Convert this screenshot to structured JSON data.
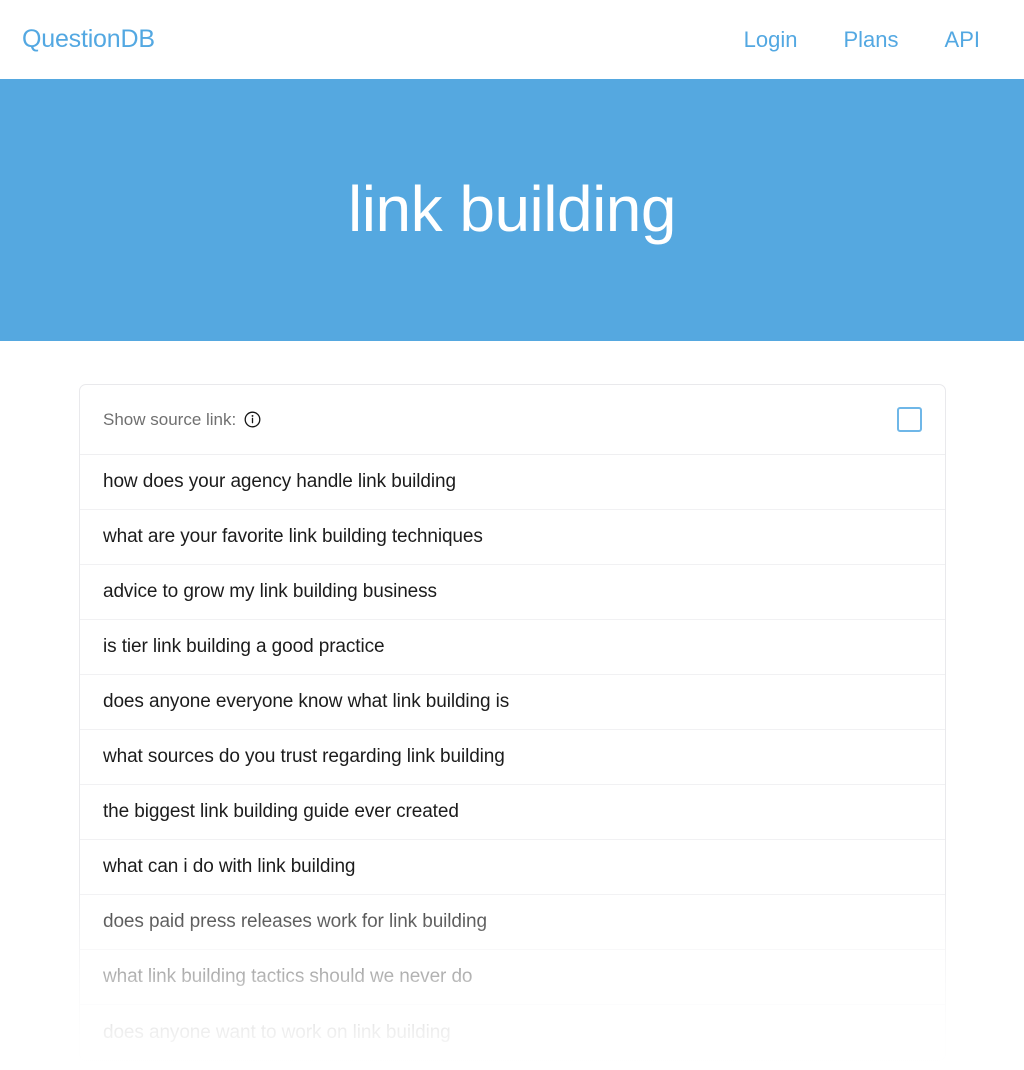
{
  "navbar": {
    "brand": "QuestionDB",
    "links": [
      {
        "label": "Login"
      },
      {
        "label": "Plans"
      },
      {
        "label": "API"
      }
    ]
  },
  "hero": {
    "title": "link building",
    "background_color": "#55a8e0",
    "text_color": "#ffffff"
  },
  "results": {
    "source_link_label": "Show source link:",
    "info_icon": "info-circle-icon",
    "show_source_link_checked": false,
    "accent_color": "#53a8e2",
    "rows": [
      {
        "text": "how does your agency handle link building"
      },
      {
        "text": "what are your favorite link building techniques"
      },
      {
        "text": "advice to grow my link building business"
      },
      {
        "text": "is tier link building a good practice"
      },
      {
        "text": "does anyone everyone know what link building is"
      },
      {
        "text": "what sources do you trust regarding link building"
      },
      {
        "text": "the biggest link building guide ever created"
      },
      {
        "text": "what can i do with link building"
      },
      {
        "text": "does paid press releases work for link building"
      },
      {
        "text": "what link building tactics should we never do"
      },
      {
        "text": "does anyone want to work on link building"
      }
    ]
  }
}
